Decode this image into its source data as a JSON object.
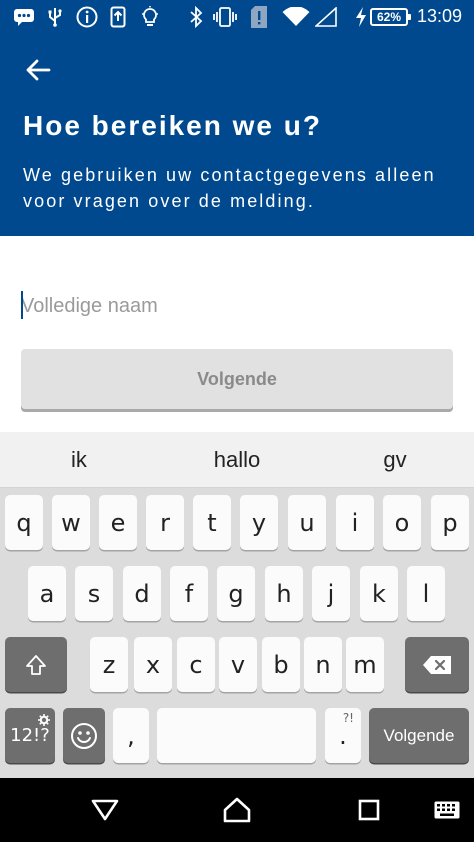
{
  "status_bar": {
    "time": "13:09",
    "battery_percent": "62%",
    "icons": [
      "chat-icon",
      "usb-icon",
      "info-icon",
      "update-icon",
      "lightbulb-icon",
      "bluetooth-icon",
      "vibrate-icon",
      "sim-alert-icon",
      "wifi-icon",
      "signal-icon",
      "charging-icon",
      "battery-icon"
    ]
  },
  "header": {
    "back_icon": "arrow-left-icon",
    "title": "Hoe bereiken we u?",
    "subtitle": "We gebruiken uw contactgegevens alleen voor vragen over de melding."
  },
  "form": {
    "name_field": {
      "value": "",
      "placeholder": "Volledige naam"
    },
    "next_button_label": "Volgende"
  },
  "suggestions": [
    "ik",
    "hallo",
    "gv"
  ],
  "keyboard": {
    "row1": [
      "q",
      "w",
      "e",
      "r",
      "t",
      "y",
      "u",
      "i",
      "o",
      "p"
    ],
    "row2": [
      "a",
      "s",
      "d",
      "f",
      "g",
      "h",
      "j",
      "k",
      "l"
    ],
    "row3": [
      "z",
      "x",
      "c",
      "v",
      "b",
      "n",
      "m"
    ],
    "symbols_label": "12!?",
    "comma_label": ",",
    "period_label": ".",
    "period_hint": "?!",
    "enter_label": "Volgende"
  },
  "nav_bar": {
    "icons": [
      "back-triangle-icon",
      "home-icon",
      "recents-icon",
      "keyboard-switch-icon"
    ]
  },
  "colors": {
    "brand_blue": "#00498f",
    "button_disabled": "#e1e1e1",
    "keyboard_bg": "#dcdcdc"
  }
}
